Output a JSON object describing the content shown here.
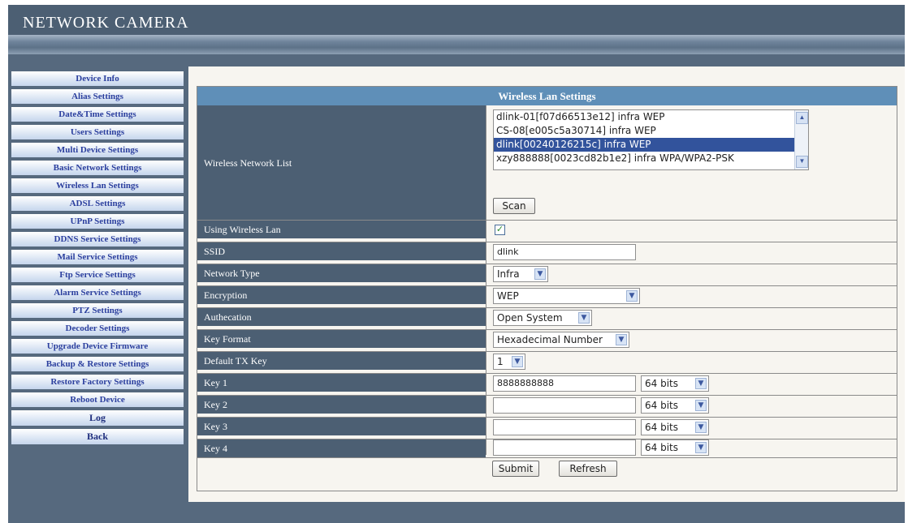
{
  "header": {
    "title": "NETWORK CAMERA"
  },
  "sidebar": {
    "items": [
      {
        "label": "Device Info"
      },
      {
        "label": "Alias Settings"
      },
      {
        "label": "Date&Time Settings"
      },
      {
        "label": "Users Settings"
      },
      {
        "label": "Multi Device Settings"
      },
      {
        "label": "Basic Network Settings"
      },
      {
        "label": "Wireless Lan Settings"
      },
      {
        "label": "ADSL Settings"
      },
      {
        "label": "UPnP Settings"
      },
      {
        "label": "DDNS Service Settings"
      },
      {
        "label": "Mail Service Settings"
      },
      {
        "label": "Ftp Service Settings"
      },
      {
        "label": "Alarm Service Settings"
      },
      {
        "label": "PTZ Settings"
      },
      {
        "label": "Decoder Settings"
      },
      {
        "label": "Upgrade Device Firmware"
      },
      {
        "label": "Backup & Restore Settings"
      },
      {
        "label": "Restore Factory Settings"
      },
      {
        "label": "Reboot Device"
      },
      {
        "label": "Log"
      },
      {
        "label": "Back"
      }
    ]
  },
  "panel": {
    "title": "Wireless Lan Settings",
    "network_list_label": "Wireless Network List",
    "networks": [
      "dlink-01[f07d66513e12] infra WEP",
      "CS-08[e005c5a30714] infra WEP",
      "dlink[00240126215c] infra WEP",
      "xzy888888[0023cd82b1e2] infra WPA/WPA2-PSK"
    ],
    "selected_network_index": 2,
    "scan_label": "Scan",
    "using_wireless_label": "Using Wireless Lan",
    "using_wireless_checked": true,
    "ssid_label": "SSID",
    "ssid_value": "dlink",
    "network_type_label": "Network Type",
    "network_type_value": "Infra",
    "encryption_label": "Encryption",
    "encryption_value": "WEP",
    "authentication_label": "Authecation",
    "authentication_value": "Open System",
    "key_format_label": "Key Format",
    "key_format_value": "Hexadecimal Number",
    "default_tx_key_label": "Default TX Key",
    "default_tx_key_value": "1",
    "keys": [
      {
        "label": "Key 1",
        "value": "8888888888",
        "bits": "64 bits"
      },
      {
        "label": "Key 2",
        "value": "",
        "bits": "64 bits"
      },
      {
        "label": "Key 3",
        "value": "",
        "bits": "64 bits"
      },
      {
        "label": "Key 4",
        "value": "",
        "bits": "64 bits"
      }
    ],
    "submit_label": "Submit",
    "refresh_label": "Refresh"
  },
  "icons": {
    "dropdown": "chevron-down-icon",
    "scroll_up": "chevron-up-icon",
    "scroll_down": "chevron-down-icon",
    "check": "check-icon"
  },
  "colors": {
    "header_bg": "#4c5f73",
    "label_bg": "#4c5f73",
    "title_bar": "#5f8fb8",
    "selection": "#32539c",
    "nav_text": "#2b3f9e"
  }
}
